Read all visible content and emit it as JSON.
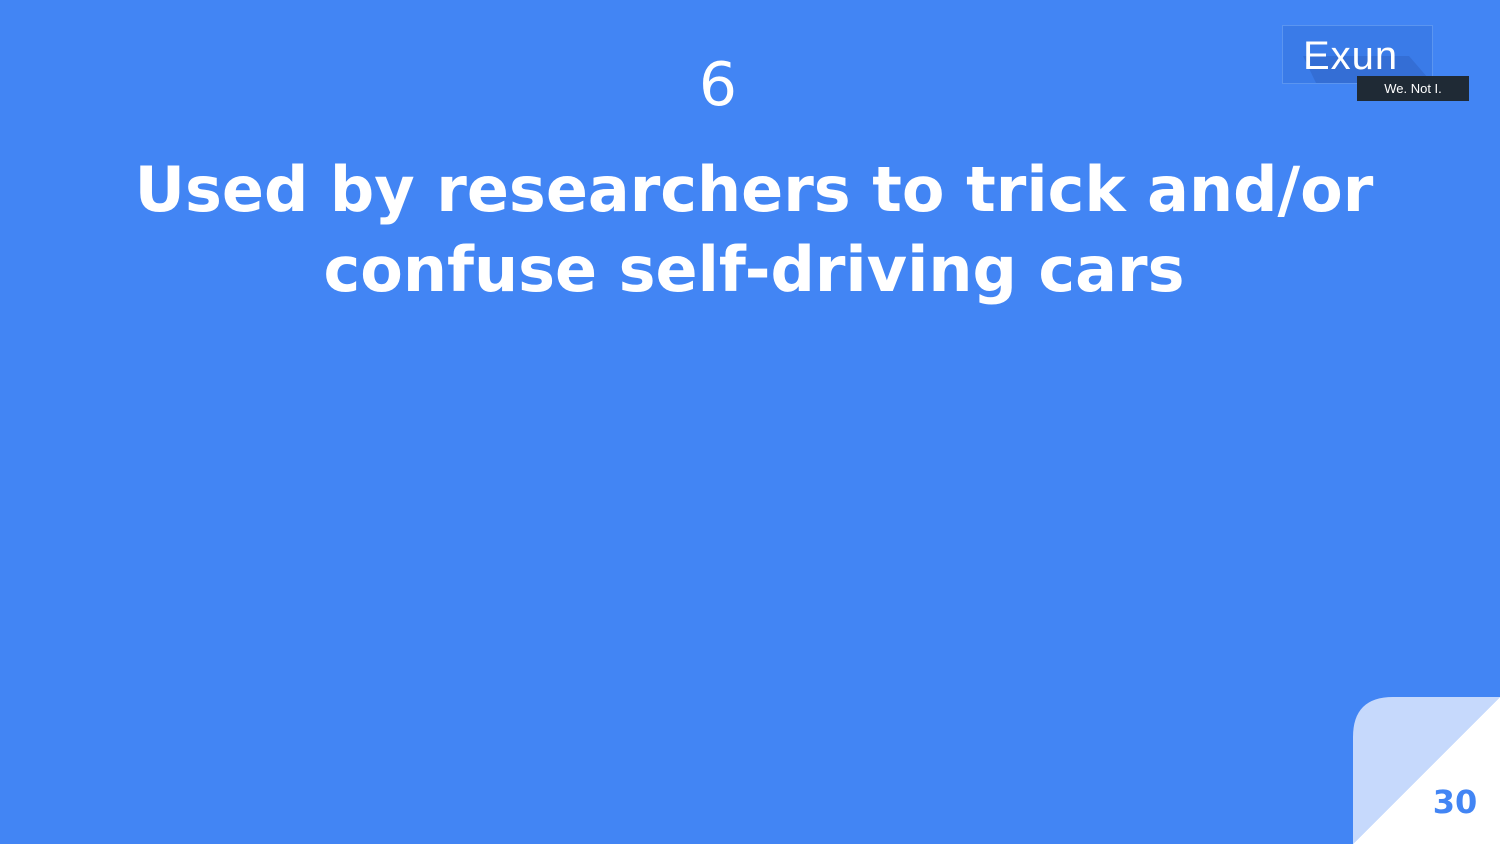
{
  "slide": {
    "question_number": "6",
    "question_text": "Used by researchers to trick and/or confuse self-driving cars",
    "page_number": "30"
  },
  "logo": {
    "word": "Exun",
    "tagline": "We. Not I.",
    "colors": {
      "box": "#3a7be8",
      "tagline_bg": "#1f2a35"
    }
  },
  "theme": {
    "background": "#4285f4",
    "corner_light": "#c6d9fc",
    "corner_white": "#ffffff",
    "text": "#ffffff"
  }
}
